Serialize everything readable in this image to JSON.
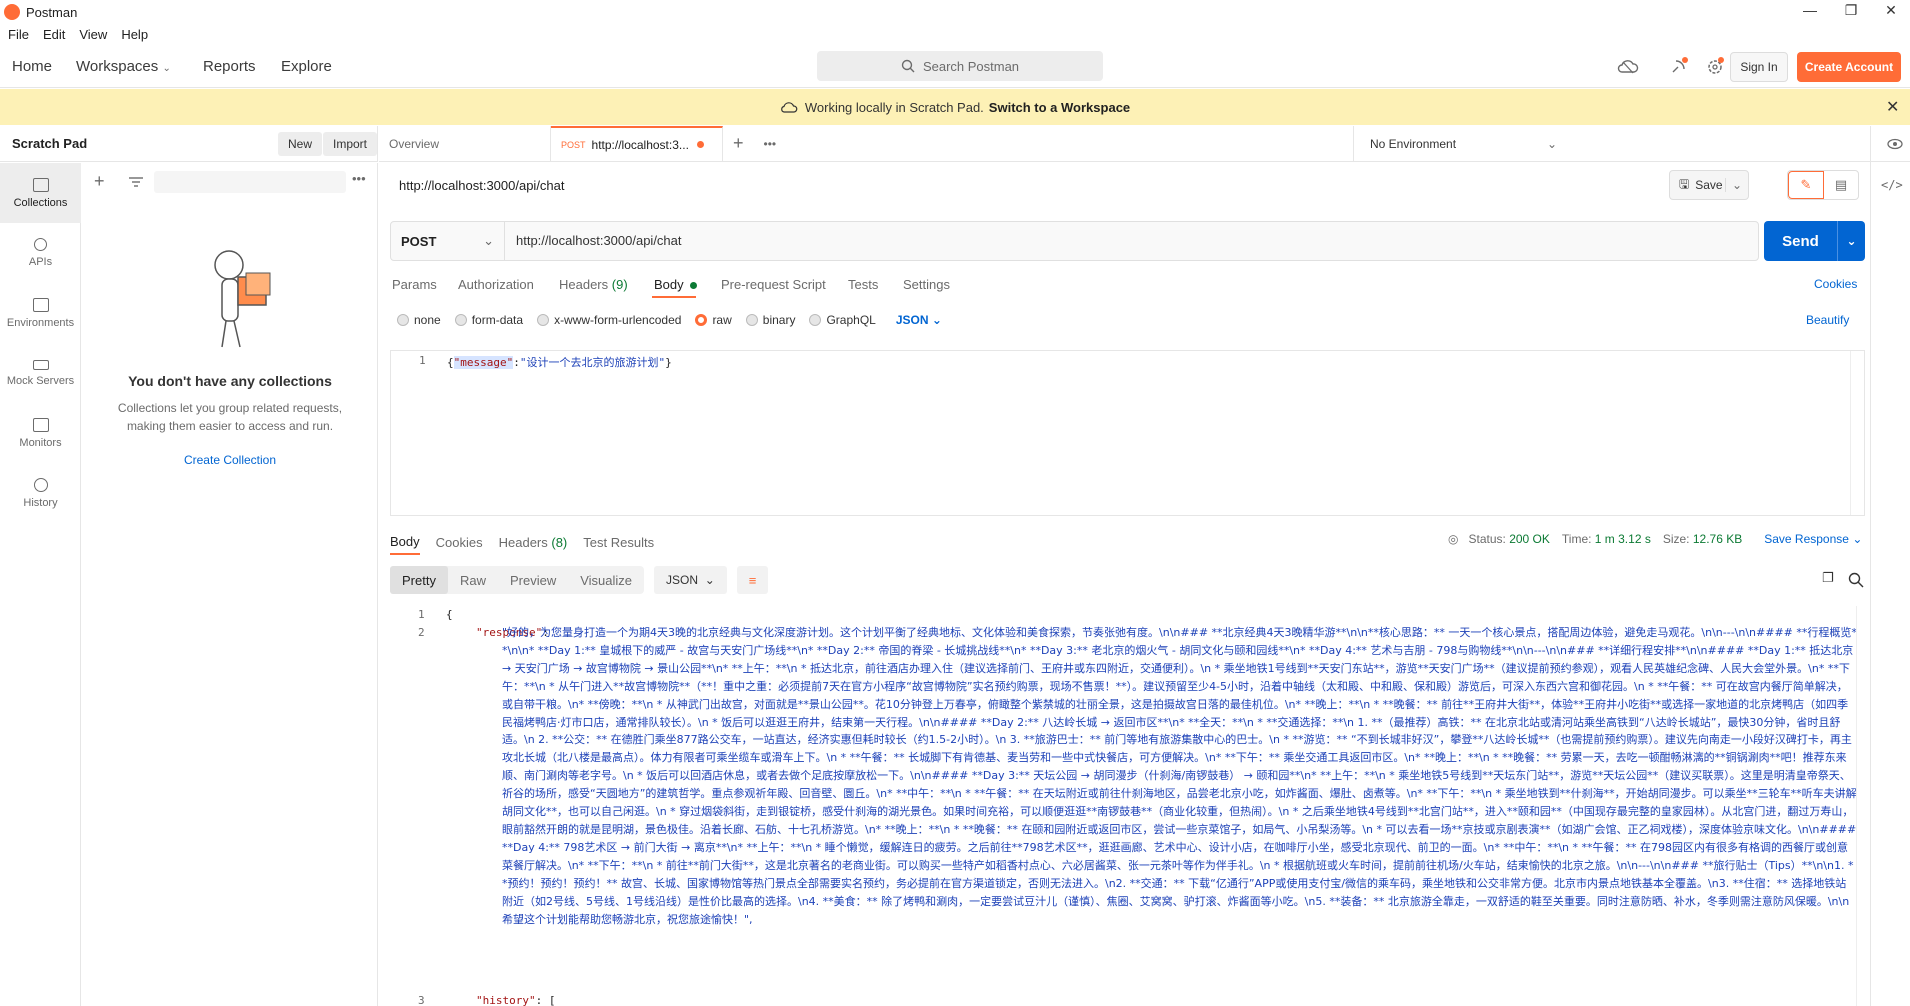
{
  "window": {
    "title": "Postman",
    "min_icon": "—",
    "restore_icon": "❐",
    "close_icon": "✕"
  },
  "menu": [
    "File",
    "Edit",
    "View",
    "Help"
  ],
  "nav": {
    "home": "Home",
    "workspaces": "Workspaces",
    "reports": "Reports",
    "explore": "Explore"
  },
  "search": {
    "placeholder": "Search Postman"
  },
  "auth": {
    "signin": "Sign In",
    "create": "Create Account"
  },
  "banner": {
    "text": "Working locally in Scratch Pad.",
    "link": "Switch to a Workspace"
  },
  "sidebar": {
    "title": "Scratch Pad",
    "new": "New",
    "import": "Import",
    "items": [
      {
        "label": "Collections",
        "icon": "collections-icon"
      },
      {
        "label": "APIs",
        "icon": "apis-icon"
      },
      {
        "label": "Environments",
        "icon": "environments-icon"
      },
      {
        "label": "Mock Servers",
        "icon": "mock-servers-icon"
      },
      {
        "label": "Monitors",
        "icon": "monitors-icon"
      },
      {
        "label": "History",
        "icon": "history-icon"
      }
    ],
    "empty_title": "You don't have any collections",
    "empty_desc1": "Collections let you group related requests,",
    "empty_desc2": "making them easier to access and run.",
    "create_collection": "Create Collection"
  },
  "tabs": {
    "overview": "Overview",
    "active_method": "POST",
    "active_url": "http://localhost:3...",
    "more": "•••",
    "environment": "No Environment"
  },
  "request": {
    "title": "http://localhost:3000/api/chat",
    "save": "Save",
    "method": "POST",
    "url": "http://localhost:3000/api/chat",
    "send": "Send",
    "subtabs": {
      "params": "Params",
      "authorization": "Authorization",
      "headers": "Headers",
      "headers_count": "(9)",
      "body": "Body",
      "prerequest": "Pre-request Script",
      "tests": "Tests",
      "settings": "Settings",
      "cookies": "Cookies"
    },
    "body_types": [
      "none",
      "form-data",
      "x-www-form-urlencoded",
      "raw",
      "binary",
      "GraphQL"
    ],
    "body_lang": "JSON",
    "beautify": "Beautify",
    "body_line_no": "1",
    "body_key": "\"message\"",
    "body_value": "\"设计一个去北京的旅游计划\""
  },
  "response": {
    "tabs": {
      "body": "Body",
      "cookies": "Cookies",
      "headers": "Headers",
      "headers_count": "(8)",
      "tests": "Test Results"
    },
    "status_label": "Status:",
    "status": "200 OK",
    "time_label": "Time:",
    "time": "1 m 3.12 s",
    "size_label": "Size:",
    "size": "12.76 KB",
    "save": "Save Response",
    "views": {
      "pretty": "Pretty",
      "raw": "Raw",
      "preview": "Preview",
      "visualize": "Visualize"
    },
    "lang": "JSON",
    "line1": "{",
    "key_response": "\"response\"",
    "text": "\"好的，为您量身打造一个为期4天3晚的北京经典与文化深度游计划。这个计划平衡了经典地标、文化体验和美食探索，节奏张弛有度。\\n\\n### **北京经典4天3晚精华游**\\n\\n**核心思路：** 一天一个核心景点，搭配周边体验，避免走马观花。\\n\\n---\\n\\n#### **行程概览**\\n\\n*   **Day 1:** 皇城根下的威严 - 故宫与天安门广场线**\\n*   **Day 2:** 帝国的脊梁 - 长城挑战线**\\n*   **Day 3:** 老北京的烟火气 - 胡同文化与颐和园线**\\n*   **Day 4:** 艺术与吉朋 - 798与购物线**\\n\\n---\\n\\n### **详细行程安排**\\n\\n#### **Day 1:** 抵达北京 → 天安门广场 → 故宫博物院 → 景山公园**\\n*   **上午：**\\n    *   抵达北京，前往酒店办理入住（建议选择前门、王府井或东四附近，交通便利）。\\n    *   乘坐地铁1号线到**天安门东站**，游览**天安门广场**（建议提前预约参观），观看人民英雄纪念碑、人民大会堂外景。\\n*   **下午：**\\n    *   从午门进入**故宫博物院**（**！重中之重：必须提前7天在官方小程序“故宫博物院”实名预约购票，现场不售票！**）。建议预留至少4-5小时，沿着中轴线（太和殿、中和殿、保和殿）游览后，可深入东西六宫和御花园。\\n    *   **午餐：** 可在故宫内餐厅简单解决，或自带干粮。\\n*   **傍晚：**\\n    *   从神武门出故宫，对面就是**景山公园**。花10分钟登上万春亭，俯瞰整个紫禁城的壮丽全景，这是拍摄故宫日落的最佳机位。\\n*   **晚上：**\\n    *   **晚餐：** 前往**王府井大街**，体验**王府井小吃街**或选择一家地道的北京烤鸭店（如四季民福烤鸭店·灯市口店，通常排队较长）。\\n    *   饭后可以逛逛王府井，结束第一天行程。\\n\\n#### **Day 2:** 八达岭长城 → 返回市区**\\n*   **全天：**\\n    *   **交通选择：**\\n        1.  **（最推荐）高铁：** 在北京北站或清河站乘坐高铁到“八达岭长城站”，最快30分钟，省时且舒适。\\n        2.  **公交：** 在德胜门乘坐877路公交车，一站直达，经济实惠但耗时较长（约1.5-2小时）。\\n        3.  **旅游巴士：** 前门等地有旅游集散中心的巴士。\\n    *   **游览：** “不到长城非好汉”，攀登**八达岭长城**（也需提前预约购票）。建议先向南走一小段好汉碑打卡，再主攻北长城（北八楼是最高点）。体力有限者可乘坐缆车或滑车上下。\\n    *   **午餐：** 长城脚下有肯德基、麦当劳和一些中式快餐店，可方便解决。\\n*   **下午：** 乘坐交通工具返回市区。\\n*   **晚上：**\\n    *   **晚餐：** 劳累一天，去吃一顿酣畅淋漓的**铜锅涮肉**吧！推荐东来顺、南门涮肉等老字号。\\n    *   饭后可以回酒店休息，或者去做个足底按摩放松一下。\\n\\n#### **Day 3:** 天坛公园 → 胡同漫步（什刹海/南锣鼓巷） → 颐和园**\\n*   **上午：**\\n    *   乘坐地铁5号线到**天坛东门站**，游览**天坛公园**（建议买联票）。这里是明清皇帝祭天、祈谷的场所，感受“天圆地方”的建筑哲学。重点参观祈年殿、回音壁、圜丘。\\n*   **中午：**\\n    *   **午餐：** 在天坛附近或前往什刹海地区，品尝老北京小吃，如炸酱面、爆肚、卤煮等。\\n*   **下午：**\\n    *   乘坐地铁到**什刹海**，开始胡同漫步。可以乘坐**三轮车**听车夫讲解胡同文化**，也可以自己闲逛。\\n    *   穿过烟袋斜街，走到银锭桥，感受什刹海的湖光景色。如果时间充裕，可以顺便逛逛**南锣鼓巷**（商业化较重，但热闹）。\\n    *   之后乘坐地铁4号线到**北宫门站**，进入**颐和园**（中国现存最完整的皇家园林）。从北宫门进，翻过万寿山，眼前豁然开朗的就是昆明湖，景色极佳。沿着长廊、石舫、十七孔桥游览。\\n*   **晚上：**\\n    *   **晚餐：** 在颐和园附近或返回市区，尝试一些京菜馆子，如局气、小吊梨汤等。\\n    *   可以去看一场**京技或京剧表演**（如湖广会馆、正乙祠戏楼），深度体验京味文化。\\n\\n#### **Day 4:** 798艺术区 → 前门大街 → 离京**\\n*   **上午：**\\n    *   睡个懒觉，缓解连日的疲劳。之后前往**798艺术区**，逛逛画廊、艺术中心、设计小店，在咖啡厅小坐，感受北京现代、前卫的一面。\\n*   **中午：**\\n    *   **午餐：** 在798园区内有很多有格调的西餐厅或创意菜餐厅解决。\\n*   **下午：**\\n    *   前往**前门大街**，这是北京著名的老商业街。可以购买一些特产如稻香村点心、六必居酱菜、张一元茶叶等作为伴手礼。\\n    *   根据航班或火车时间，提前前往机场/火车站，结束愉快的北京之旅。\\n\\n---\\n\\n### **旅行贴士（Tips）**\\n\\n1.  **预约！预约！预约！** 故宫、长城、国家博物馆等热门景点全部需要实名预约，务必提前在官方渠道锁定，否则无法进入。\\n2.  **交通：** 下载“亿通行”APP或使用支付宝/微信的乘车码，乘坐地铁和公交非常方便。北京市内景点地铁基本全覆盖。\\n3.  **住宿：** 选择地铁站附近（如2号线、5号线、1号线沿线）是性价比最高的选择。\\n4.  **美食：** 除了烤鸭和涮肉，一定要尝试豆汁儿（谨慎）、焦圈、艾窝窝、驴打滚、炸酱面等小吃。\\n5.  **装备：** 北京旅游全靠走，一双舒适的鞋至关重要。同时注意防晒、补水，冬季则需注意防风保暖。\\n\\n希望这个计划能帮助您畅游北京，祝您旅途愉快！\",",
    "key_history": "\"history\"",
    "history_open": "["
  },
  "colors": {
    "brand": "#ff6c37",
    "send": "#0265d2",
    "banner": "#fdf1b6",
    "status_ok": "#0c7a34"
  }
}
